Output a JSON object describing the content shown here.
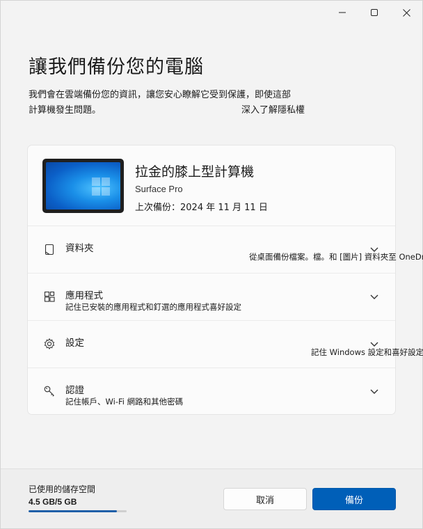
{
  "window": {
    "title": "",
    "controls": {
      "minimize": "minimize-icon",
      "maximize": "maximize-icon",
      "close": "close-icon"
    }
  },
  "header": {
    "title": "讓我們備份您的電腦",
    "description": "我們會在雲端備份您的資訊，讓您安心瞭解它受到保護，即使這部計算機發生問題。",
    "privacy_link": "深入了解隱私權"
  },
  "device": {
    "name": "拉金的膝上型計算機",
    "model": "Surface Pro",
    "last_backup": "上次備份：2024 年 11 月 11 日",
    "image_icon": "windows-logo-icon"
  },
  "items": [
    {
      "title": "資料夾",
      "subtitle": "從桌面備份檔案。檔。和 [圖片] 資料夾至 OneDrive",
      "icon": "folder-icon"
    },
    {
      "title": "應用程式",
      "subtitle": "記住已安裝的應用程式和釘選的應用程式喜好設定",
      "icon": "apps-icon"
    },
    {
      "title": "設定",
      "subtitle": "記住 Windows 設定和喜好設定",
      "icon": "gear-icon"
    },
    {
      "title": "認證",
      "subtitle": "記住帳戶、Wi-Fi 網路和其他密碼",
      "icon": "key-icon"
    }
  ],
  "footer": {
    "storage_label": "已使用的儲存空間",
    "storage_value": "4.5 GB/5 GB",
    "storage_fraction": 0.9,
    "cancel_label": "取消",
    "backup_label": "備份"
  },
  "colors": {
    "accent": "#005fb8",
    "progress": "#1f5fa8",
    "background": "#f3f3f3"
  }
}
